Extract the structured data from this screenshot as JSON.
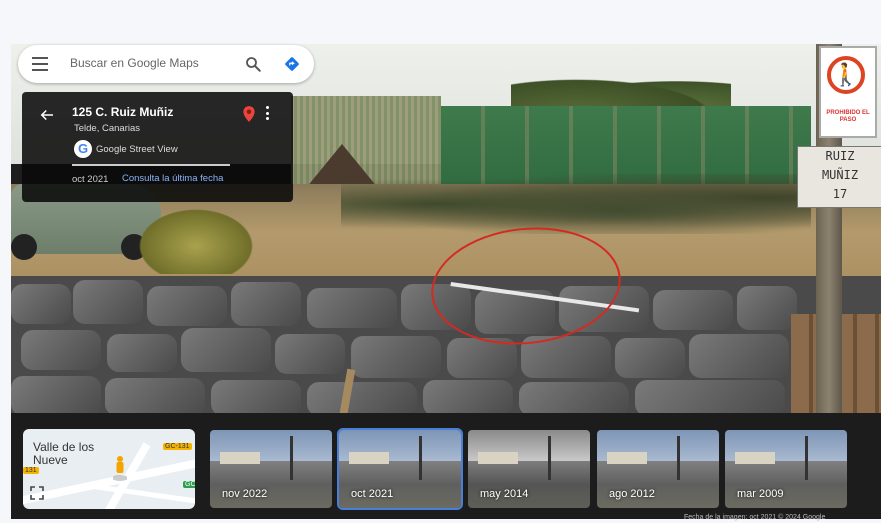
{
  "search": {
    "placeholder": "Buscar en Google Maps"
  },
  "info_card": {
    "address": "125 C. Ruiz Muñiz",
    "locality": "Telde, Canarias",
    "source": "Google Street View",
    "capture_date": "oct 2021",
    "latest_link": "Consulta la última fecha"
  },
  "scene": {
    "sign_text": "PROHIBIDO EL PASO",
    "street_plate": [
      "RUIZ",
      "MUÑIZ",
      "17"
    ]
  },
  "minimap": {
    "title": "Valle de los Nueve",
    "road_tag": "GC-131",
    "road_tag_2": "131",
    "road_tag_3": "GC"
  },
  "timeline": [
    {
      "label": "nov 2022",
      "selected": false
    },
    {
      "label": "oct 2021",
      "selected": true
    },
    {
      "label": "may 2014",
      "selected": false
    },
    {
      "label": "ago 2012",
      "selected": false
    },
    {
      "label": "mar 2009",
      "selected": false
    }
  ],
  "footer": {
    "text": "Fecha de la imagen: oct 2021    © 2024 Google"
  },
  "colors": {
    "accent": "#4a7fd9",
    "link": "#8ab4f8",
    "annotation": "#d42a22",
    "pin": "#e8453c"
  }
}
